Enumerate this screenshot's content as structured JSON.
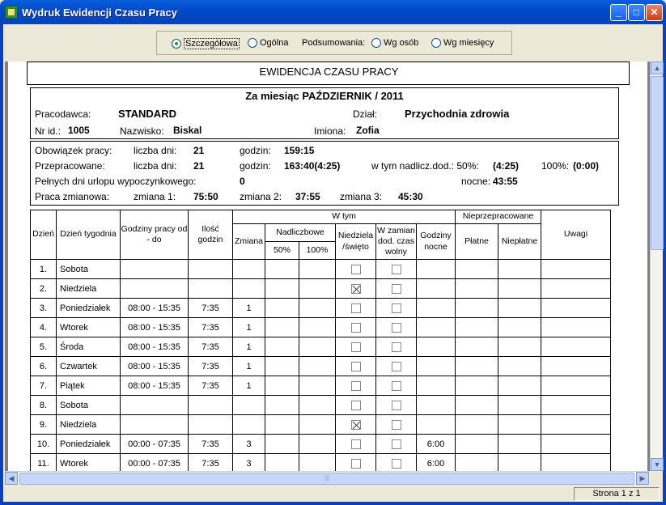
{
  "window": {
    "title": "Wydruk Ewidencji Czasu Pracy",
    "min_glyph": "_",
    "max_glyph": "□",
    "close_glyph": "✕"
  },
  "options": {
    "detailed": "Szczegółowa",
    "general": "Ogólna",
    "summaries_label": "Podsumowania:",
    "by_persons": "Wg osób",
    "by_months": "Wg miesięcy",
    "selected": "detailed"
  },
  "report": {
    "title": "EWIDENCJA CZASU PRACY",
    "month_line": "Za miesiąc PAŹDZIERNIK / 2011",
    "employer_label": "Pracodawca:",
    "employer": "STANDARD",
    "dept_label": "Dział:",
    "dept": "Przychodnia zdrowia",
    "id_label": "Nr id.:",
    "id": "1005",
    "surname_label": "Nazwisko:",
    "surname": "Biskal",
    "names_label": "Imiona:",
    "names": "Zofia"
  },
  "summary": {
    "obligation_label": "Obowiązek pracy:",
    "days_label": "liczba dni:",
    "obligation_days": "21",
    "hours_label": "godzin:",
    "obligation_hours": "159:15",
    "worked_label": "Przepracowane:",
    "worked_days": "21",
    "worked_hours": "163:40(4:25)",
    "overtime50_label": "w tym nadlicz.dod.: 50%:",
    "overtime50": "(4:25)",
    "overtime100_label": "100%:",
    "overtime100": "(0:00)",
    "vacation_label": "Pełnych dni urlopu wypoczynkowego:",
    "vacation_days": "0",
    "night_label": "nocne:",
    "night": "43:55",
    "shift_label": "Praca zmianowa:",
    "shift1_label": "zmiana 1:",
    "shift1": "75:50",
    "shift2_label": "zmiana 2:",
    "shift2": "37:55",
    "shift3_label": "zmiana 3:",
    "shift3": "45:30"
  },
  "table": {
    "headers": {
      "day": "Dzień",
      "weekday": "Dzień tygodnia",
      "hours_range": "Godziny pracy od  -  do",
      "hours_count": "Ilość godzin",
      "of_which": "W tym",
      "shift": "Zmiana",
      "overtime": "Nadliczbowe",
      "ot50": "50%",
      "ot100": "100%",
      "sunday_holiday": "Niedziela /święto",
      "instead": "W zamian dod. czas wolny",
      "night_hours": "Godziny nocne",
      "unworked": "Nieprzepracowane",
      "paid": "Płatne",
      "unpaid": "Niepłatne",
      "notes": "Uwagi"
    },
    "rows": [
      {
        "day": "1.",
        "weekday": "Sobota",
        "range": "",
        "hours": "",
        "shift": "",
        "sunday": false,
        "night": ""
      },
      {
        "day": "2.",
        "weekday": "Niedziela",
        "range": "",
        "hours": "",
        "shift": "",
        "sunday": true,
        "night": ""
      },
      {
        "day": "3.",
        "weekday": "Poniedziałek",
        "range": "08:00 - 15:35",
        "hours": "7:35",
        "shift": "1",
        "sunday": false,
        "night": ""
      },
      {
        "day": "4.",
        "weekday": "Wtorek",
        "range": "08:00 - 15:35",
        "hours": "7:35",
        "shift": "1",
        "sunday": false,
        "night": ""
      },
      {
        "day": "5.",
        "weekday": "Środa",
        "range": "08:00 - 15:35",
        "hours": "7:35",
        "shift": "1",
        "sunday": false,
        "night": ""
      },
      {
        "day": "6.",
        "weekday": "Czwartek",
        "range": "08:00 - 15:35",
        "hours": "7:35",
        "shift": "1",
        "sunday": false,
        "night": ""
      },
      {
        "day": "7.",
        "weekday": "Piątek",
        "range": "08:00 - 15:35",
        "hours": "7:35",
        "shift": "1",
        "sunday": false,
        "night": ""
      },
      {
        "day": "8.",
        "weekday": "Sobota",
        "range": "",
        "hours": "",
        "shift": "",
        "sunday": false,
        "night": ""
      },
      {
        "day": "9.",
        "weekday": "Niedziela",
        "range": "",
        "hours": "",
        "shift": "",
        "sunday": true,
        "night": ""
      },
      {
        "day": "10.",
        "weekday": "Poniedziałek",
        "range": "00:00 - 07:35",
        "hours": "7:35",
        "shift": "3",
        "sunday": false,
        "night": "6:00"
      },
      {
        "day": "11.",
        "weekday": "Wtorek",
        "range": "00:00 - 07:35",
        "hours": "7:35",
        "shift": "3",
        "sunday": false,
        "night": "6:00"
      }
    ]
  },
  "status": {
    "page": "Strona 1 z 1"
  },
  "scrollbar": {
    "up": "▲",
    "down": "▼",
    "left": "◀",
    "right": "▶",
    "grip": "|||"
  }
}
